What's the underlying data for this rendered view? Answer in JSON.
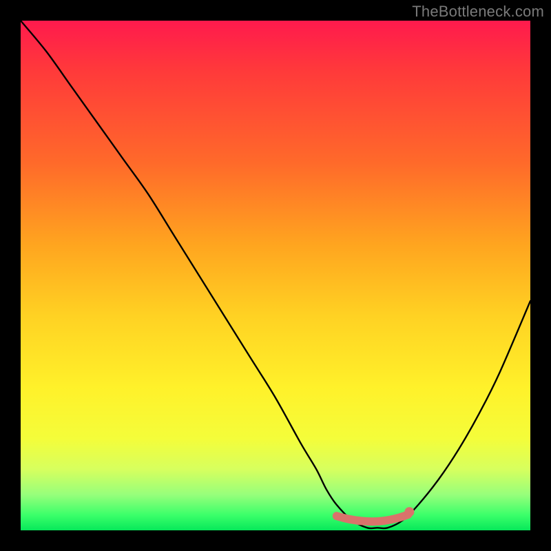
{
  "attribution": "TheBottleneck.com",
  "chart_data": {
    "type": "line",
    "title": "",
    "xlabel": "",
    "ylabel": "",
    "xlim": [
      0,
      100
    ],
    "ylim": [
      0,
      100
    ],
    "series": [
      {
        "name": "bottleneck-curve",
        "x": [
          0,
          5,
          10,
          15,
          20,
          25,
          30,
          35,
          40,
          45,
          50,
          55,
          58,
          60,
          62,
          65,
          68,
          70,
          72,
          75,
          78,
          82,
          86,
          90,
          94,
          100
        ],
        "values": [
          100,
          94,
          87,
          80,
          73,
          66,
          58,
          50,
          42,
          34,
          26,
          17,
          12,
          8,
          5,
          2,
          0.5,
          0.5,
          0.5,
          2,
          5,
          10,
          16,
          23,
          31,
          45
        ]
      }
    ],
    "highlight": {
      "name": "optimal-range",
      "x_start": 62,
      "x_end": 76,
      "y": 2
    },
    "gradient_stops": [
      {
        "pos": 0,
        "color": "#ff1a4d"
      },
      {
        "pos": 10,
        "color": "#ff3a3a"
      },
      {
        "pos": 28,
        "color": "#ff6a2a"
      },
      {
        "pos": 44,
        "color": "#ffa51f"
      },
      {
        "pos": 58,
        "color": "#ffd223"
      },
      {
        "pos": 72,
        "color": "#fff12a"
      },
      {
        "pos": 82,
        "color": "#f4fd3a"
      },
      {
        "pos": 88,
        "color": "#d7ff5e"
      },
      {
        "pos": 93,
        "color": "#97ff7b"
      },
      {
        "pos": 97,
        "color": "#3bff6a"
      },
      {
        "pos": 100,
        "color": "#07e85a"
      }
    ],
    "colors": {
      "curve": "#000000",
      "highlight": "#d9736b",
      "background_border": "#000000"
    }
  }
}
